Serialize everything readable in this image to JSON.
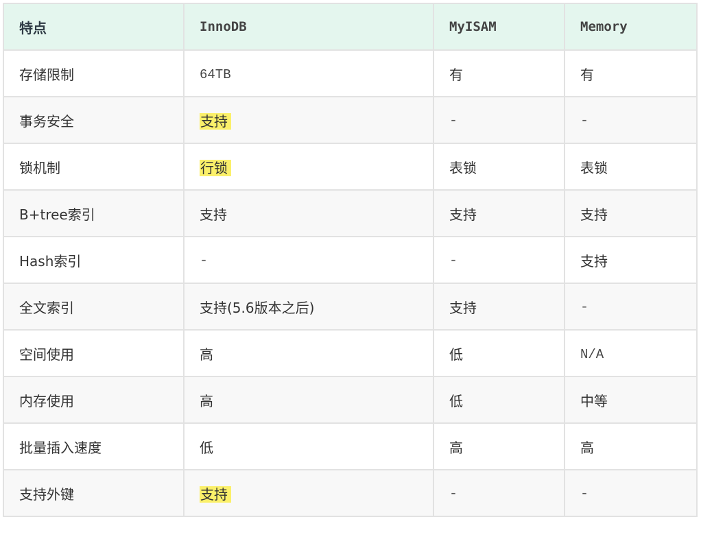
{
  "header": [
    "特点",
    "InnoDB",
    "MyISAM",
    "Memory"
  ],
  "rows": [
    [
      "存储限制",
      "64TB",
      "有",
      "有"
    ],
    [
      "事务安全",
      "支持",
      "-",
      "-"
    ],
    [
      "锁机制",
      "行锁",
      "表锁",
      "表锁"
    ],
    [
      "B+tree索引",
      "支持",
      "支持",
      "支持"
    ],
    [
      "Hash索引",
      "-",
      "-",
      "支持"
    ],
    [
      "全文索引",
      "支持(5.6版本之后)",
      "支持",
      "-"
    ],
    [
      "空间使用",
      "高",
      "低",
      "N/A"
    ],
    [
      "内存使用",
      "高",
      "低",
      "中等"
    ],
    [
      "批量插入速度",
      "低",
      "高",
      "高"
    ],
    [
      "支持外键",
      "支持",
      "-",
      "-"
    ]
  ],
  "highlights": [
    {
      "row": 1,
      "col": 1,
      "color": "#fbf06a"
    },
    {
      "row": 2,
      "col": 1,
      "color": "#fbf06a"
    },
    {
      "row": 9,
      "col": 1,
      "color": "#fbf06a"
    }
  ],
  "colors": {
    "header_bg": "#e4f6ee",
    "border": "#e2e2e2",
    "stripe_bg": "#f8f8f8",
    "highlight": "#fbf06a"
  }
}
